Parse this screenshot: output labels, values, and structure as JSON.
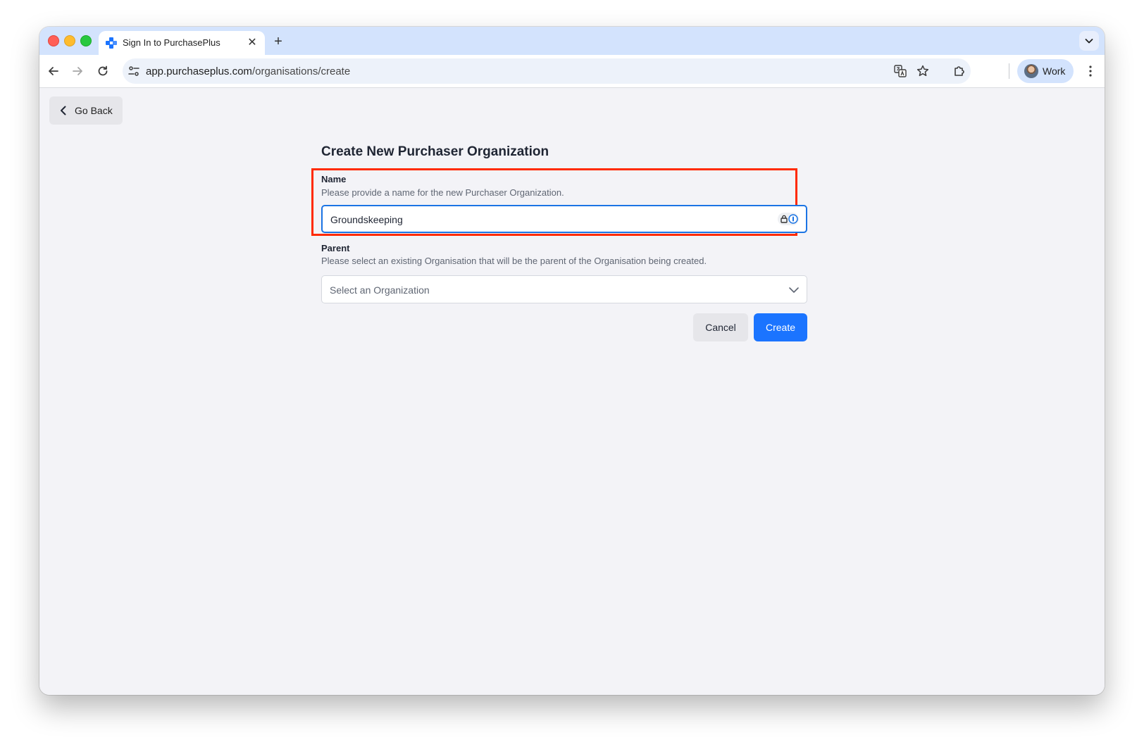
{
  "browser": {
    "tab_title": "Sign In to PurchasePlus",
    "url_host": "app.purchaseplus.com",
    "url_path": "/organisations/create",
    "profile_label": "Work"
  },
  "page": {
    "go_back_label": "Go Back",
    "title": "Create New Purchaser Organization",
    "name_label": "Name",
    "name_help": "Please provide a name for the new Purchaser Organization.",
    "name_value": "Groundskeeping",
    "parent_label": "Parent",
    "parent_help": "Please select an existing Organisation that will be the parent of the Organisation being created.",
    "parent_placeholder": "Select an Organization",
    "cancel_label": "Cancel",
    "create_label": "Create"
  },
  "colors": {
    "primary": "#1b74ff",
    "highlight": "#ff2a00",
    "tabstrip": "#d3e3fd"
  }
}
